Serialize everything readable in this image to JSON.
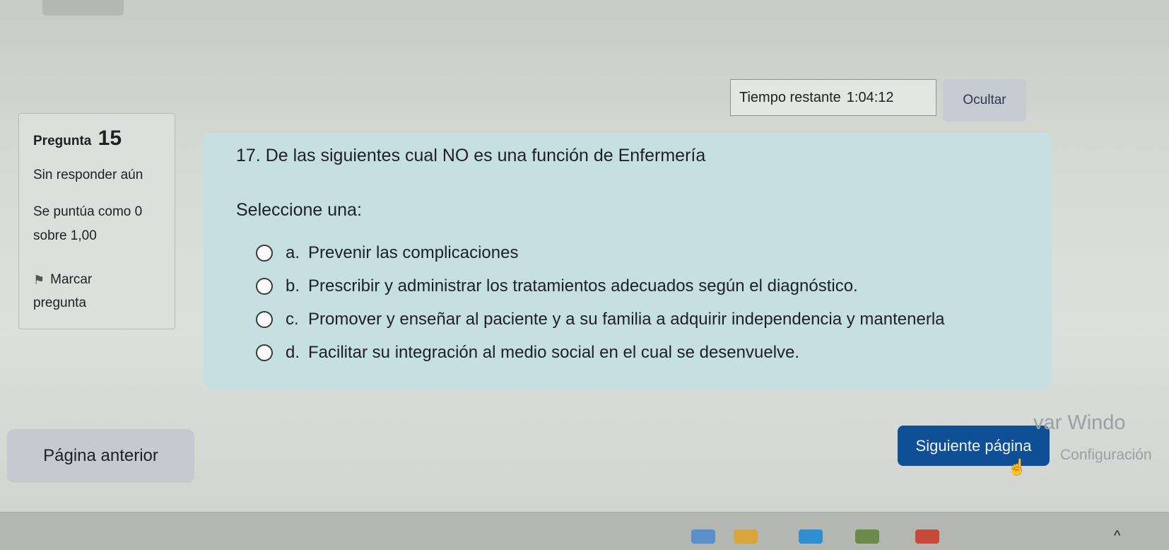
{
  "timer": {
    "label": "Tiempo restante",
    "value": "1:04:12"
  },
  "hide_button": "Ocultar",
  "question_info": {
    "title": "Pregunta",
    "number": "15",
    "status": "Sin responder aún",
    "score": "Se puntúa como 0 sobre 1,00",
    "flag_label_1": "Marcar",
    "flag_label_2": "pregunta"
  },
  "question": {
    "text": "17. De las siguientes cual NO es una función de Enfermería",
    "prompt": "Seleccione una:",
    "options": [
      {
        "letter": "a.",
        "text": "Prevenir las complicaciones"
      },
      {
        "letter": "b.",
        "text": "Prescribir y administrar los tratamientos adecuados según el diagnóstico."
      },
      {
        "letter": "c.",
        "text": "Promover y enseñar al paciente y a su familia a adquirir independencia y mantenerla"
      },
      {
        "letter": "d.",
        "text": "Facilitar su integración al medio social en el cual se desenvuelve."
      }
    ]
  },
  "nav": {
    "prev": "Página anterior",
    "next": "Siguiente página"
  },
  "watermark": {
    "line1": "var Windo",
    "line2": "Configuración"
  },
  "icons": {
    "flag": "flag-icon",
    "chevron": "chevron-up-icon",
    "cursor": "hand-cursor-icon"
  },
  "colors": {
    "next_button": "#0f4f96",
    "content_bg": "#c6e0e2",
    "prev_button": "#c3cbd1"
  }
}
